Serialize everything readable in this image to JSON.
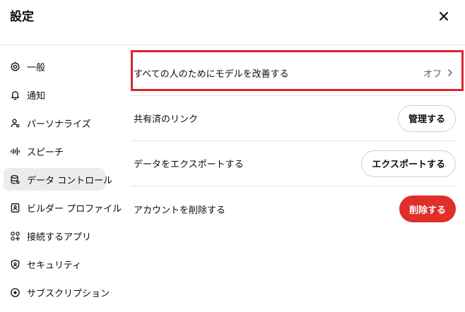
{
  "header": {
    "title": "設定"
  },
  "sidebar": {
    "items": [
      {
        "label": "一般",
        "icon": "gear-icon"
      },
      {
        "label": "通知",
        "icon": "bell-icon"
      },
      {
        "label": "パーソナライズ",
        "icon": "person-icon"
      },
      {
        "label": "スピーチ",
        "icon": "waveform-icon"
      },
      {
        "label": "データ コントロール",
        "icon": "database-icon",
        "active": true
      },
      {
        "label": "ビルダー プロファイル",
        "icon": "id-card-icon"
      },
      {
        "label": "接続するアプリ",
        "icon": "apps-icon"
      },
      {
        "label": "セキュリティ",
        "icon": "shield-icon"
      },
      {
        "label": "サブスクリプション",
        "icon": "subscription-icon"
      }
    ]
  },
  "main": {
    "improve_model": {
      "label": "すべての人のためにモデルを改善する",
      "value": "オフ"
    },
    "shared_links": {
      "label": "共有済のリンク",
      "button": "管理する"
    },
    "export_data": {
      "label": "データをエクスポートする",
      "button": "エクスポートする"
    },
    "delete_account": {
      "label": "アカウントを削除する",
      "button": "削除する"
    }
  },
  "colors": {
    "danger": "#e02e2a",
    "highlight": "#d8262d",
    "active_bg": "#ececec"
  }
}
